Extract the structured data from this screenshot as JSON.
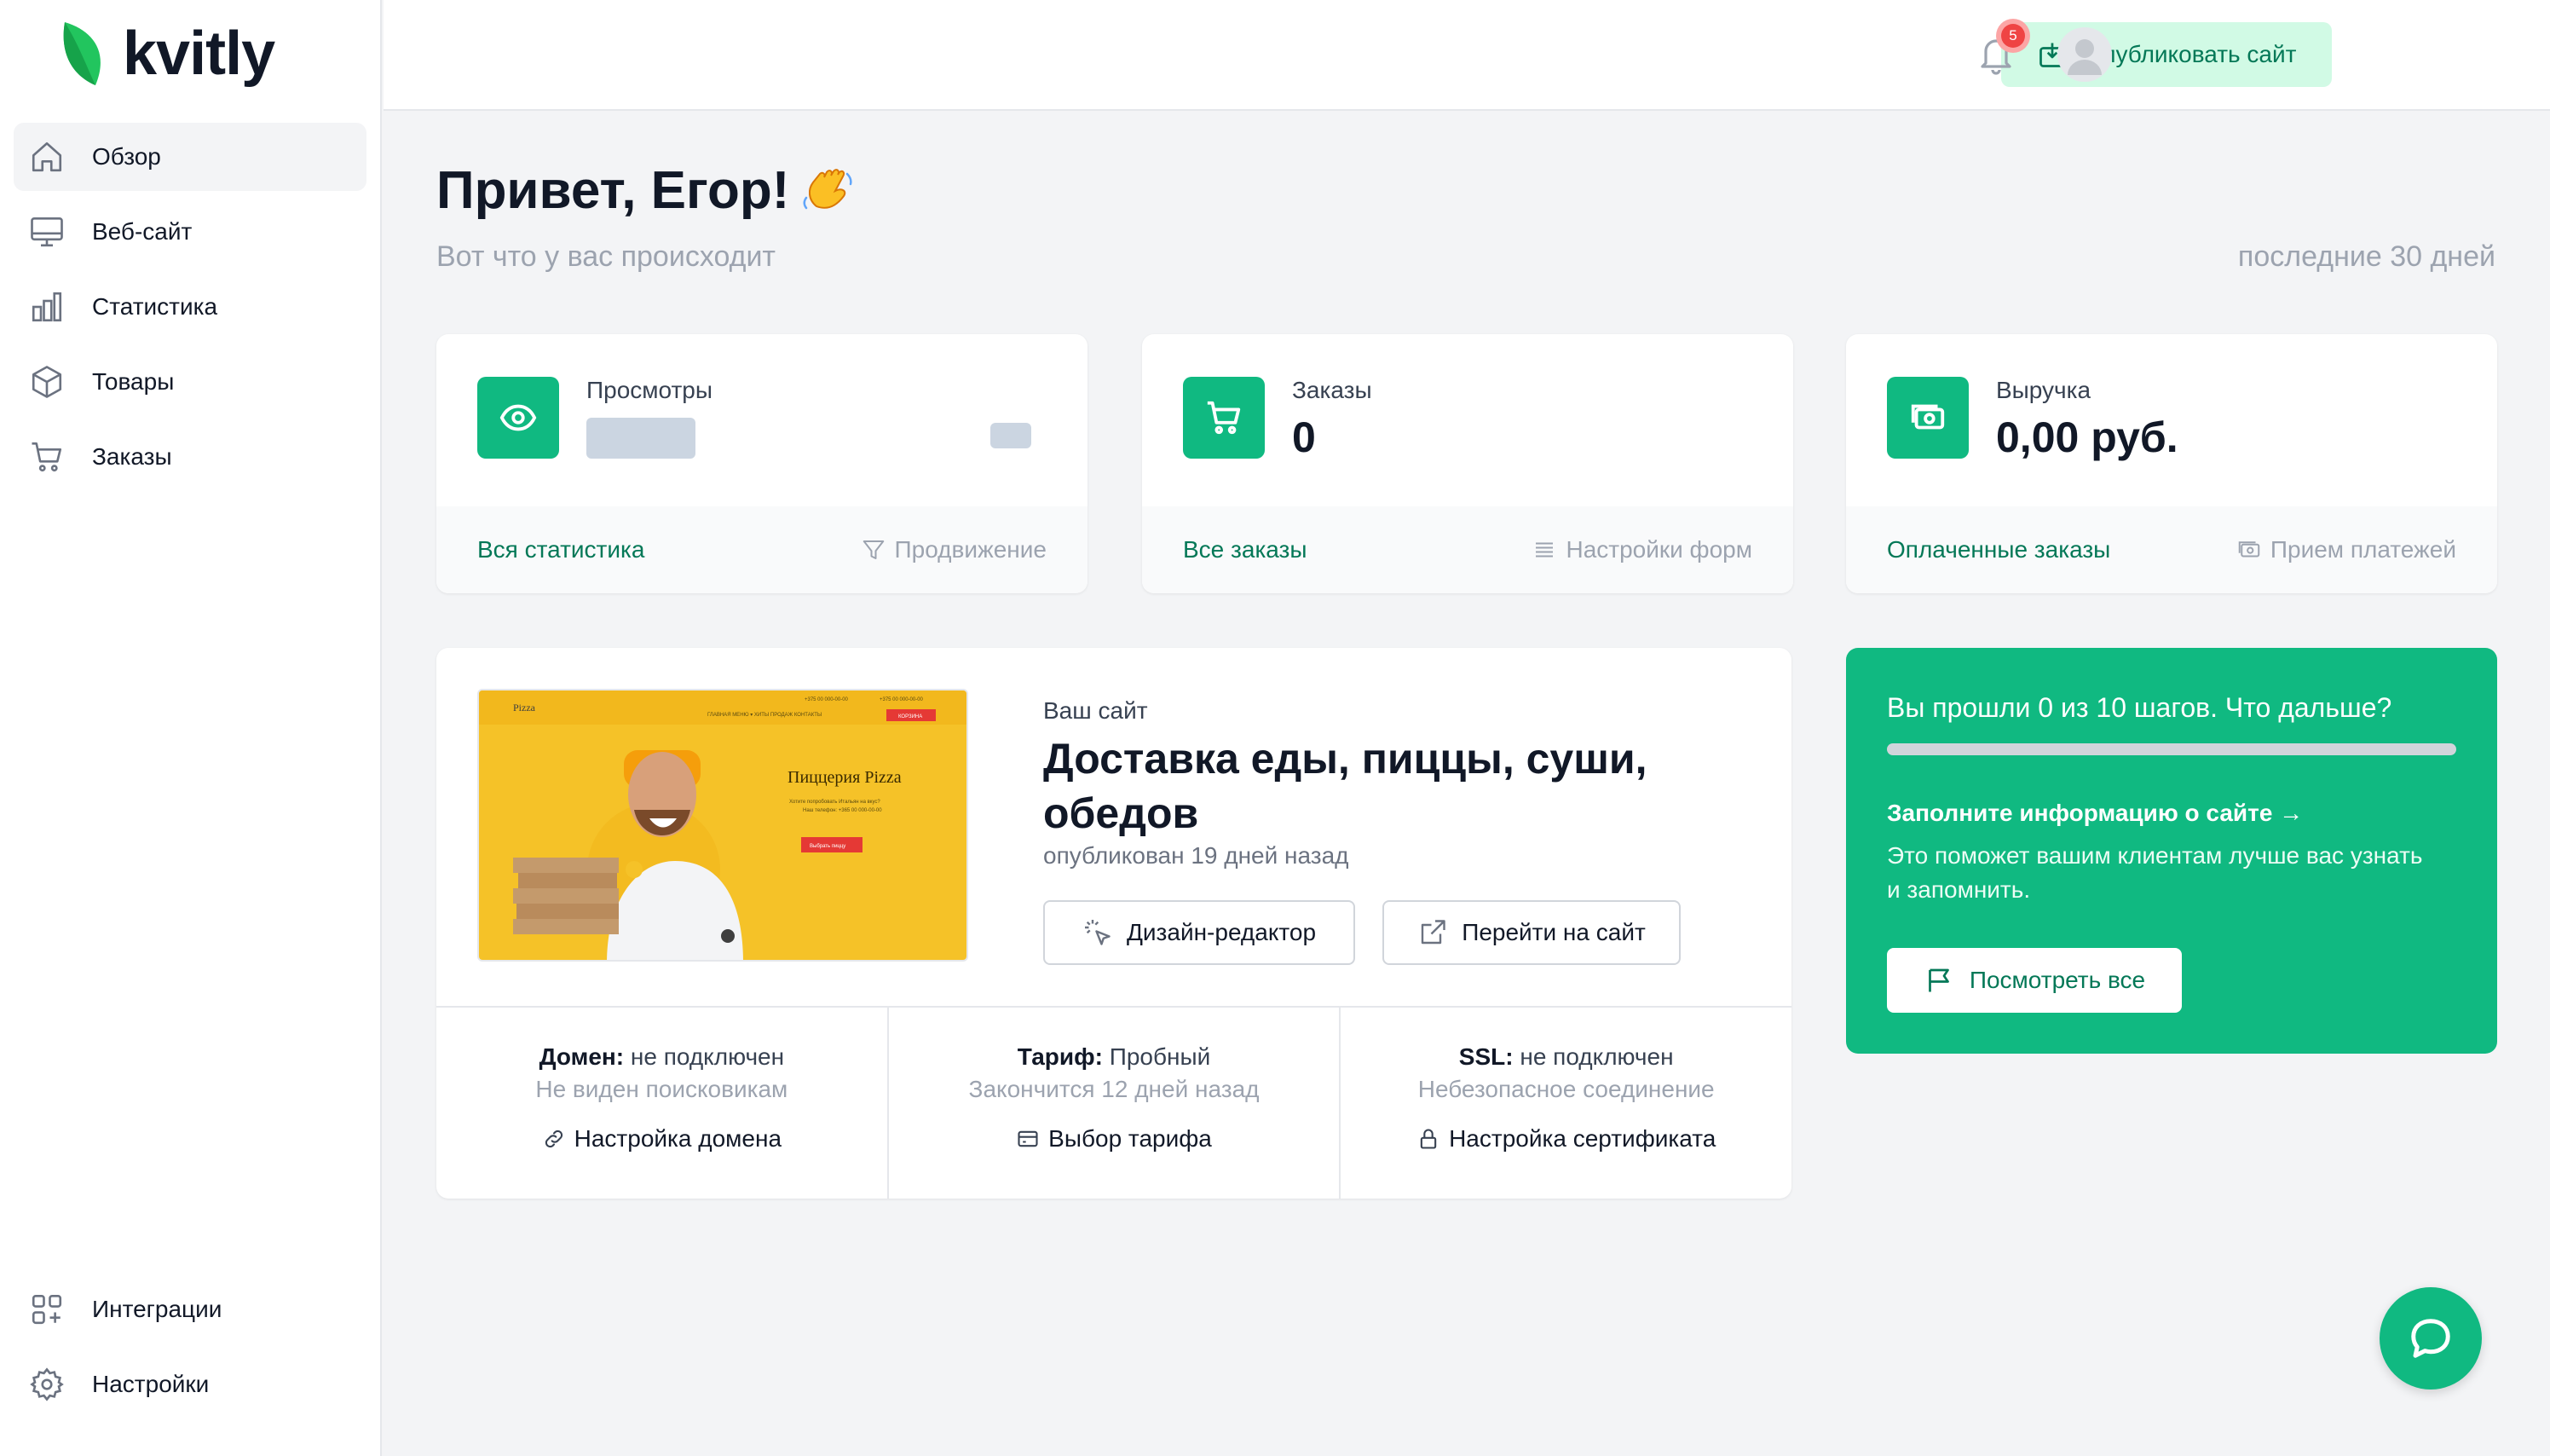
{
  "brand": {
    "name": "kvitly",
    "accent": "#10b981",
    "accent_dark": "#047857"
  },
  "sidebar": {
    "items": [
      {
        "label": "Обзор",
        "icon": "home-icon",
        "active": true
      },
      {
        "label": "Веб-сайт",
        "icon": "monitor-icon"
      },
      {
        "label": "Статистика",
        "icon": "bar-chart-icon"
      },
      {
        "label": "Товары",
        "icon": "box-icon"
      },
      {
        "label": "Заказы",
        "icon": "cart-icon"
      }
    ],
    "bottom_items": [
      {
        "label": "Интеграции",
        "icon": "integrations-icon"
      },
      {
        "label": "Настройки",
        "icon": "gear-icon"
      }
    ]
  },
  "header": {
    "publish_label": "Опубликовать сайт",
    "notifications_count": "5"
  },
  "greeting": {
    "title": "Привет, Егор!",
    "subtitle": "Вот что у вас происходит",
    "period": "последние 30 дней"
  },
  "stats": [
    {
      "label": "Просмотры",
      "value": "",
      "icon": "eye-icon",
      "link": "Вся статистика",
      "secondary": "Продвижение",
      "secondary_icon": "filter-icon"
    },
    {
      "label": "Заказы",
      "value": "0",
      "icon": "cart-icon",
      "link": "Все заказы",
      "secondary": "Настройки форм",
      "secondary_icon": "list-icon"
    },
    {
      "label": "Выручка",
      "value": "0,00 руб.",
      "icon": "money-icon",
      "link": "Оплаченные заказы",
      "secondary": "Прием платежей",
      "secondary_icon": "money-icon"
    }
  ],
  "site": {
    "kicker": "Ваш сайт",
    "title": "Доставка еды, пиццы, суши, обедов",
    "published": "опубликован 19 дней назад",
    "design_editor": "Дизайн-редактор",
    "open_site": "Перейти на сайт",
    "thumbnail": {
      "brand": "Pizza",
      "heading": "Пиццерия Pizza",
      "nav": "ГЛАВНАЯ   МЕНЮ ▾   ХИТЫ ПРОДАЖ   КОНТАКТЫ",
      "phone1": "+375 00 000-00-00",
      "phone2": "+375 00 000-00-00",
      "cart": "КОРЗИНА",
      "text1": "Хотите попробовать Итальян на вкус?",
      "text2": "Наш телефон: +365 00 000-00-00",
      "button": "Выбрать пиццу"
    },
    "domain": {
      "key": "Домен:",
      "value": "не подключен",
      "note": "Не виден поисковикам",
      "link": "Настройка домена"
    },
    "plan": {
      "key": "Тариф:",
      "value": "Пробный",
      "note": "Закончится 12 дней назад",
      "link": "Выбор тарифа"
    },
    "ssl": {
      "key": "SSL:",
      "value": "не подключен",
      "note": "Небезопасное соединение",
      "link": "Настройка сертификата"
    }
  },
  "steps": {
    "title": "Вы прошли 0 из 10 шагов. Что дальше?",
    "progress": 0,
    "link": "Заполните информацию о сайте →",
    "description": "Это поможет вашим клиентам лучше вас узнать и запомнить.",
    "button": "Посмотреть все"
  }
}
